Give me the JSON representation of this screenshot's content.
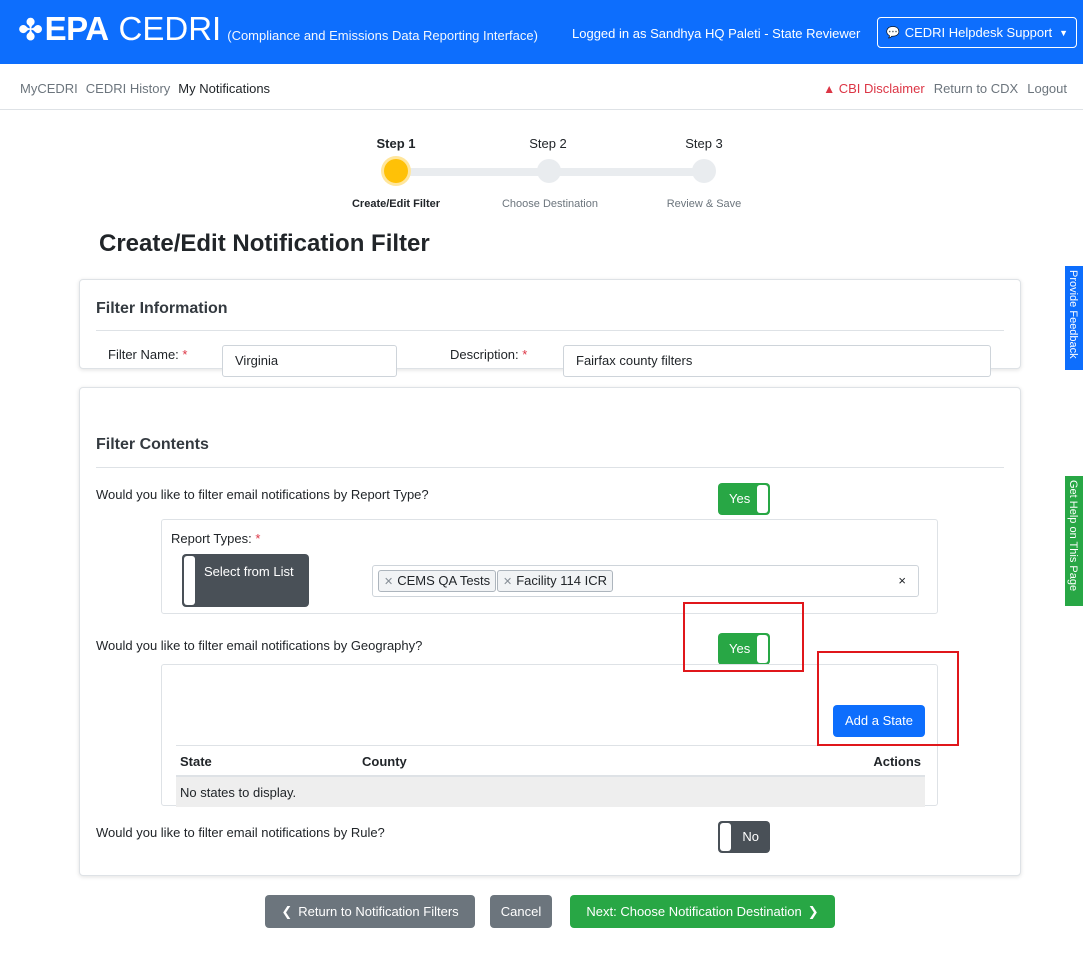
{
  "header": {
    "logo": "EPA",
    "app_name": "CEDRI",
    "app_subtitle": "(Compliance and Emissions Data Reporting Interface)",
    "logged_in_text": "Logged in as Sandhya HQ Paleti - State Reviewer",
    "helpdesk_label": "CEDRI Helpdesk Support",
    "primary_color": "#0d6efd"
  },
  "nav": {
    "items": [
      "MyCEDRI",
      "CEDRI History",
      "My Notifications"
    ],
    "cbi_disclaimer": "CBI Disclaimer",
    "return_cdx": "Return to CDX",
    "logout": "Logout"
  },
  "stepper": {
    "steps": [
      {
        "top": "Step 1",
        "label": "Create/Edit Filter",
        "active": true
      },
      {
        "top": "Step 2",
        "label": "Choose Destination",
        "active": false
      },
      {
        "top": "Step 3",
        "label": "Review & Save",
        "active": false
      }
    ],
    "active_color": "#ffc107"
  },
  "page_title": "Create/Edit Notification Filter",
  "filter_info": {
    "title": "Filter Information",
    "name_label": "Filter Name:",
    "name_value": "Virginia",
    "description_label": "Description:",
    "description_value": "Fairfax county filters"
  },
  "filter_contents": {
    "title": "Filter Contents",
    "report_type_question": "Would you like to filter email notifications by Report Type?",
    "report_type_toggle": "Yes",
    "report_types_label": "Report Types:",
    "select_from_list": "Select from List",
    "selected_report_types": [
      "CEMS QA Tests",
      "Facility 114 ICR"
    ],
    "clear_symbol": "×",
    "geography_question": "Would you like to filter email notifications by Geography?",
    "geography_toggle": "Yes",
    "add_state": "Add a State",
    "table_headers": {
      "state": "State",
      "county": "County",
      "actions": "Actions"
    },
    "empty_message": "No states to display.",
    "rule_question": "Would you like to filter email notifications by Rule?",
    "rule_toggle": "No"
  },
  "footer_buttons": {
    "return": "Return to Notification Filters",
    "cancel": "Cancel",
    "next": "Next: Choose Notification Destination"
  },
  "side_tabs": {
    "feedback": "Provide Feedback",
    "help": "Get Help on This Page"
  },
  "colors": {
    "success": "#28a745",
    "secondary": "#6c757d",
    "highlight": "#e0171b"
  }
}
